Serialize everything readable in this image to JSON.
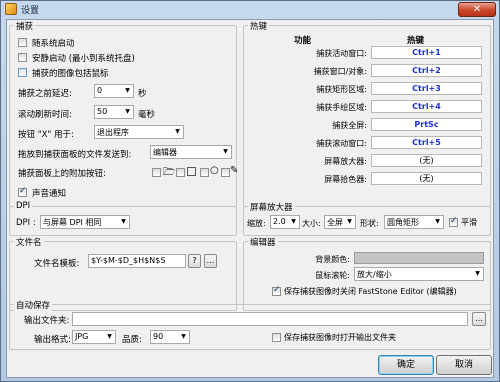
{
  "window": {
    "title": "设置",
    "close": "✕"
  },
  "capture": {
    "legend": "捕获",
    "cb_startup": "随系统启动",
    "cb_tray": "安静启动 (最小到系统托盘)",
    "cb_cursor": "捕获的图像包括鼠标",
    "delay_label": "捕获之前延迟:",
    "delay_value": "0",
    "delay_unit": "秒",
    "scroll_label": "滚动刷新时间:",
    "scroll_value": "50",
    "scroll_unit": "毫秒",
    "x_label": "按钮 \"X\" 用于:",
    "x_value": "退出程序",
    "drag_label": "拖放到捕获面板的文件发送到:",
    "drag_value": "编辑器",
    "extra_label": "捕获面板上的附加按钮:",
    "cb_sound": "声音通知"
  },
  "hotkeys": {
    "legend": "热键",
    "col_function": "功能",
    "col_hotkey": "热键",
    "rows": [
      {
        "label": "捕获活动窗口:",
        "key": "Ctrl+1",
        "plain": false
      },
      {
        "label": "捕获窗口/对象:",
        "key": "Ctrl+2",
        "plain": false
      },
      {
        "label": "捕获矩形区域:",
        "key": "Ctrl+3",
        "plain": false
      },
      {
        "label": "捕获手绘区域:",
        "key": "Ctrl+4",
        "plain": false
      },
      {
        "label": "捕获全屏:",
        "key": "PrtSc",
        "plain": false
      },
      {
        "label": "捕获滚动窗口:",
        "key": "Ctrl+5",
        "plain": false
      },
      {
        "label": "屏幕放大器:",
        "key": "(无)",
        "plain": true
      },
      {
        "label": "屏幕拾色器:",
        "key": "(无)",
        "plain": true
      }
    ]
  },
  "dpi": {
    "legend": "DPI",
    "label": "DPI :",
    "value": "与屏幕 DPI 相同"
  },
  "magnifier": {
    "legend": "屏幕放大器",
    "zoom_label": "缩放:",
    "zoom_value": "2.0",
    "size_label": "大小:",
    "size_value": "全屏",
    "shape_label": "形状:",
    "shape_value": "圆角矩形",
    "smooth": "平滑"
  },
  "filename": {
    "legend": "文件名",
    "label": "文件名模板:",
    "value": "$Y-$M-$D_$H$N$S",
    "help": "?",
    "more": "..."
  },
  "editor": {
    "legend": "编辑器",
    "bg_label": "背景颜色:",
    "wheel_label": "鼠标滚轮:",
    "wheel_value": "放大/缩小",
    "cb_open": "保存捕获图像时关闭 FastStone Editor (编辑器)"
  },
  "autosave": {
    "legend": "自动保存",
    "folder_label": "输出文件夹:",
    "folder_value": "",
    "browse": "...",
    "format_label": "输出格式:",
    "format_value": "JPG",
    "quality_label": "品质:",
    "quality_value": "90",
    "cb_open_folder": "保存捕获图像时打开输出文件夹"
  },
  "buttons": {
    "ok": "确定",
    "cancel": "取消"
  }
}
